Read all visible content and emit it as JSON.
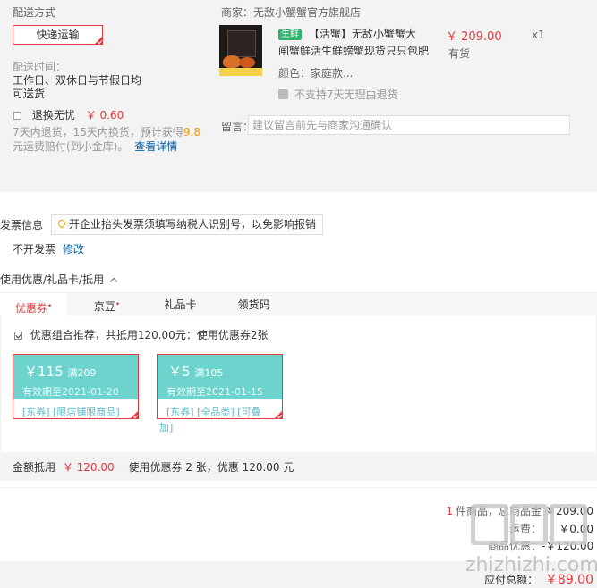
{
  "shipping": {
    "title": "配送方式",
    "method": "快递运输",
    "time_label": "配送时间：",
    "time_value_1": "工作日、双休日与节假日均",
    "time_value_2": "可送货",
    "insurance_label": "退换无忧",
    "insurance_price": "￥ 0.60",
    "insurance_desc_1": "7天内退货，15天内换货，预计获得",
    "insurance_points": "9.8",
    "insurance_desc_2": "元运费赔付(到小金库)。",
    "insurance_link": "查看详情"
  },
  "seller": {
    "label": "商家：无敌小蟹蟹官方旗舰店",
    "product_tag": "生鲜",
    "product_title_1": "【活蟹】无敌小蟹蟹大",
    "product_title_2": "闸蟹鲜活生鲜螃蟹现货只只包肥",
    "product_price": "￥ 209.00",
    "product_qty": "x1",
    "product_stock": "有货",
    "product_color": "颜色：家庭款...",
    "no_return": "不支持7天无理由退货",
    "remark_label": "留言：",
    "remark_placeholder": "建议留言前先与商家沟通确认"
  },
  "invoice": {
    "title": "发票信息",
    "tip": "开企业抬头发票须填写纳税人识别号，以免影响报销",
    "status": "不开发票",
    "edit_link": "修改"
  },
  "discount": {
    "title": "使用优惠/礼品卡/抵用",
    "toggle_icon": "chevron-up-icon",
    "tabs": [
      {
        "label": "优惠券",
        "star": "•"
      },
      {
        "label": "京豆",
        "star": "•"
      },
      {
        "label": "礼品卡",
        "star": ""
      },
      {
        "label": "领货码",
        "star": ""
      }
    ],
    "combo_text": "优惠组合推荐，共抵用120.00元：使用优惠券2张",
    "coupons": [
      {
        "amount": "￥115",
        "condition": "满209",
        "expiry": "有效期至2021-01-20",
        "scope": "[东券] [限店铺限商品]"
      },
      {
        "amount": "￥5",
        "condition": "满105",
        "expiry": "有效期至2021-01-15",
        "scope": "[东券] [全品类] [可叠",
        "scope_2": "加]"
      }
    ],
    "summary_label": "金额抵用",
    "summary_amount": "￥ 120.00",
    "summary_text": "使用优惠券 2 张，优惠 120.00 元"
  },
  "totals": {
    "count": "1",
    "count_text": "件商品，总商品金",
    "goods_amount": "￥209.00",
    "freight_label": "运费：",
    "freight_amount": "￥0.00",
    "discount_label": "商品优惠：",
    "discount_amount": "-￥120.00",
    "pay_label": "应付总额：",
    "pay_amount": "￥89.00"
  },
  "watermark": "zhizhizhi.com",
  "colors": {
    "accent": "#e4393c",
    "link": "#005ea7",
    "coupon": "#6dd3cd",
    "fresh": "#32b16c"
  }
}
